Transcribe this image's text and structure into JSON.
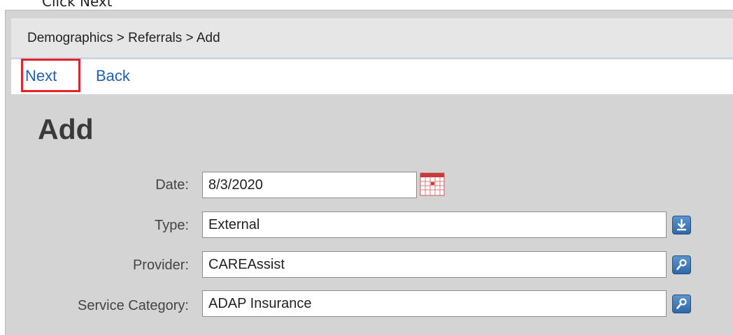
{
  "instruction": "Click Next",
  "breadcrumb": "Demographics > Referrals > Add",
  "actions": {
    "next": "Next",
    "back": "Back"
  },
  "page_title": "Add",
  "form": {
    "date": {
      "label": "Date:",
      "value": "8/3/2020"
    },
    "type": {
      "label": "Type:",
      "value": "External"
    },
    "provider": {
      "label": "Provider:",
      "value": "CAREAssist"
    },
    "service_category": {
      "label": "Service Category:",
      "value": "ADAP Insurance"
    }
  },
  "icons": {
    "calendar": "calendar-icon",
    "type_dropdown": "download-arrow-icon",
    "provider_lookup": "magnifier-icon",
    "service_lookup": "magnifier-icon"
  },
  "colors": {
    "link": "#1f5fb5",
    "highlight": "#e8202a",
    "panel_bg": "#d4d4d4",
    "button_blue": "#2e67a8"
  }
}
